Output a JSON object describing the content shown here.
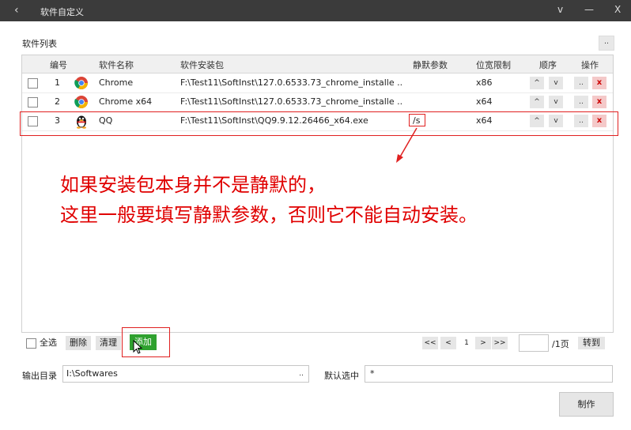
{
  "window": {
    "title": "软件自定义",
    "back_icon": "‹",
    "dropdown_icon": "v",
    "minimize_icon": "—",
    "close_icon": "X"
  },
  "section_label": "软件列表",
  "more_button": "..",
  "table": {
    "headers": {
      "index": "编号",
      "name": "软件名称",
      "package": "软件安装包",
      "silent": "静默参数",
      "arch": "位宽限制",
      "order": "顺序",
      "ops": "操作"
    },
    "rows": [
      {
        "index": "1",
        "icon": "chrome-icon",
        "name": "Chrome",
        "package": "F:\\Test11\\SoftInst\\127.0.6533.73_chrome_installe ..",
        "silent": "",
        "arch": "x86",
        "up": "^",
        "down": "v",
        "edit": "..",
        "delete": "x"
      },
      {
        "index": "2",
        "icon": "chrome-icon",
        "name": "Chrome x64",
        "package": "F:\\Test11\\SoftInst\\127.0.6533.73_chrome_installe ..",
        "silent": "",
        "arch": "x64",
        "up": "^",
        "down": "v",
        "edit": "..",
        "delete": "x"
      },
      {
        "index": "3",
        "icon": "qq-penguin-icon",
        "name": "QQ",
        "package": "F:\\Test11\\SoftInst\\QQ9.9.12.26466_x64.exe",
        "silent": "/s",
        "arch": "x64",
        "up": "^",
        "down": "v",
        "edit": "..",
        "delete": "x"
      }
    ]
  },
  "annotation": {
    "line1": "如果安装包本身并不是静默的，",
    "line2": "这里一般要填写静默参数，否则它不能自动安装。"
  },
  "controls": {
    "select_all": "全选",
    "delete": "删除",
    "clear": "清理",
    "add": "添加",
    "first": "<<",
    "prev": "<",
    "page": "1",
    "next": ">",
    "last": ">>",
    "page_input": "",
    "total_pages": "/1页",
    "goto": "转到"
  },
  "output": {
    "label": "输出目录",
    "value": "I:\\Softwares",
    "browse": ".."
  },
  "default_select": {
    "label": "默认选中",
    "value": "*"
  },
  "make_button": "制作",
  "colors": {
    "titlebar": "#3b3b3b",
    "highlight": "#e02020",
    "add_button": "#2fa12f",
    "delete_button_bg": "#f4c9c9"
  }
}
